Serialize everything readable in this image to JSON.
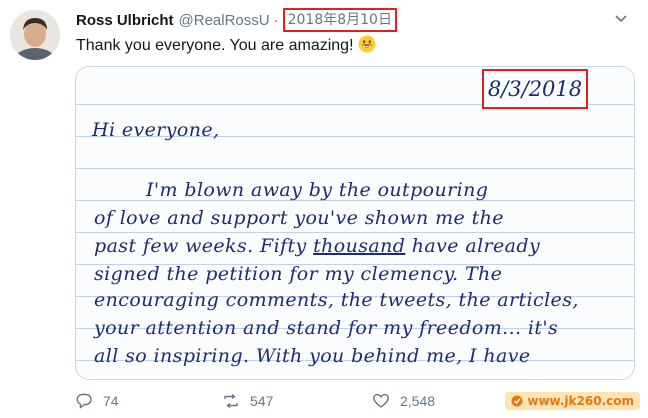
{
  "tweet": {
    "author_name": "Ross Ulbricht",
    "handle": "@RealRossU",
    "separator": "·",
    "date": "2018年8月10日",
    "text": "Thank you everyone. You are amazing!",
    "emoji": "grinning-face-emoji"
  },
  "letter": {
    "date": "8/3/2018",
    "greeting": "Hi everyone,",
    "lines": [
      "I'm blown away by the outpouring",
      "of love and support you've shown me the",
      "past few weeks. Fifty ",
      "signed the petition for my clemency. The",
      "encouraging comments, the tweets, the articles,",
      "your attention and stand for my freedom... it's",
      "all so inspiring. With you behind me, I have"
    ],
    "underlined_word": "thousand",
    "line3_tail": " have already"
  },
  "actions": {
    "reply_count": "74",
    "retweet_count": "547",
    "like_count": "2,548"
  },
  "watermark": "www.jk260.com",
  "colors": {
    "highlight_box": "#e02020",
    "ink": "#1f2b70",
    "secondary_text": "#657786"
  }
}
